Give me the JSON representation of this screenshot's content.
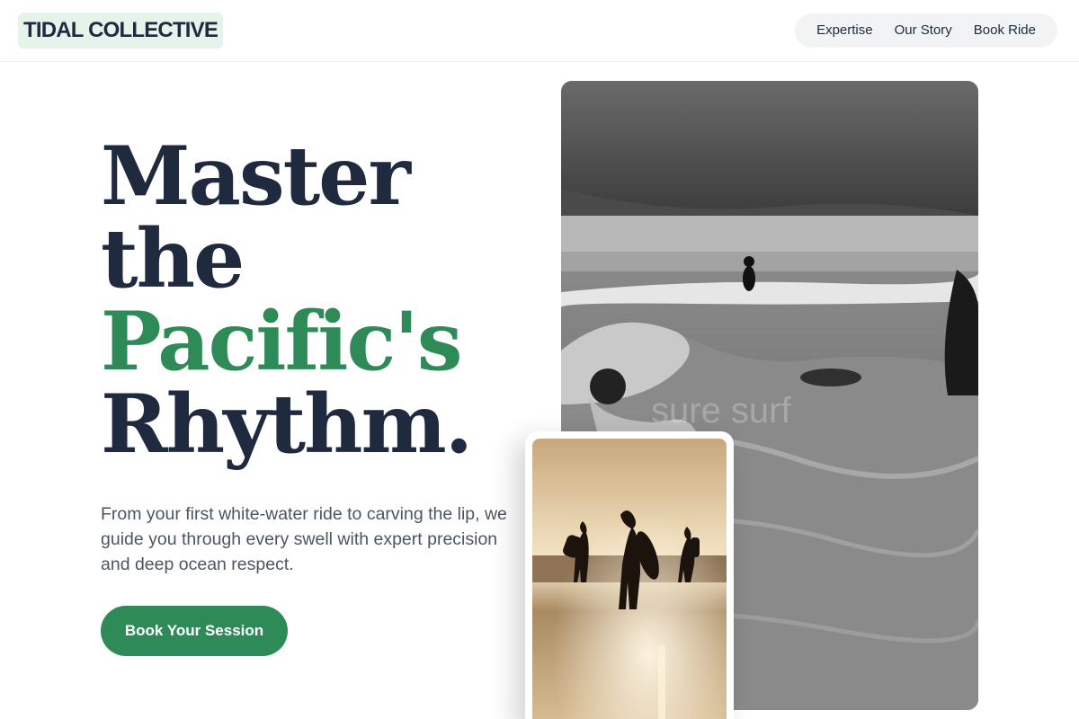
{
  "brand": {
    "name": "TIDAL COLLECTIVE"
  },
  "nav": {
    "items": [
      "Expertise",
      "Our Story",
      "Book Ride"
    ]
  },
  "hero": {
    "title_lines": [
      "Master",
      "the",
      "Pacific's",
      "Rhythm."
    ],
    "accent_line_color": "#2e8b57",
    "subtitle": "From your first white-water ride to carving the lip, we guide you through every swell with expert precision and deep ocean respect.",
    "cta_label": "Book Your Session"
  },
  "images": {
    "main": {
      "description_icon": "surf-photo",
      "watermark": "sure surf"
    },
    "card": {
      "description_icon": "sunset-surfers-photo"
    }
  },
  "colors": {
    "brand_green": "#2e8b57",
    "ink": "#1f2a3f",
    "logo_bg": "#e6f3ea"
  }
}
